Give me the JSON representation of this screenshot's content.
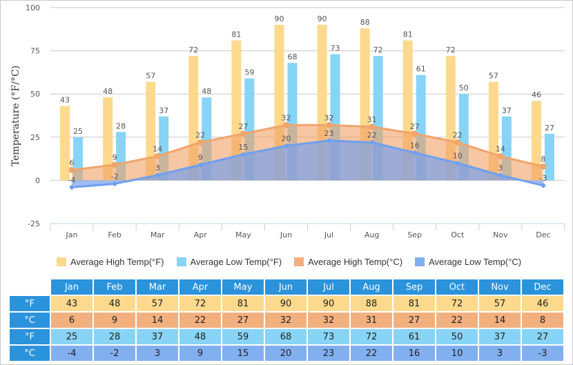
{
  "chart_data": {
    "type": "bar",
    "title": "",
    "xlabel": "",
    "ylabel": "Temperature (°F/°C)",
    "ylim": [
      -25,
      100
    ],
    "yticks": [
      -25,
      0,
      25,
      50,
      75,
      100
    ],
    "grid": true,
    "categories": [
      "Jan",
      "Feb",
      "Mar",
      "Apr",
      "May",
      "Jun",
      "Jul",
      "Aug",
      "Sep",
      "Oct",
      "Nov",
      "Dec"
    ],
    "series": [
      {
        "name": "Average High Temp(°F)",
        "type": "bar",
        "color": "#fcd98c",
        "values": [
          43,
          48,
          57,
          72,
          81,
          90,
          90,
          88,
          81,
          72,
          57,
          46
        ]
      },
      {
        "name": "Average Low Temp(°F)",
        "type": "bar",
        "color": "#88d4f6",
        "values": [
          25,
          28,
          37,
          48,
          59,
          68,
          73,
          72,
          61,
          50,
          37,
          27
        ]
      },
      {
        "name": "Average High Temp(°C)",
        "type": "area",
        "color": "#f2b07e",
        "values": [
          6,
          9,
          14,
          22,
          27,
          32,
          32,
          31,
          27,
          22,
          14,
          8
        ]
      },
      {
        "name": "Average Low Temp(°C)",
        "type": "area",
        "color": "#82aff0",
        "values": [
          -4,
          -2,
          3,
          9,
          15,
          20,
          23,
          22,
          16,
          10,
          3,
          -3
        ]
      }
    ],
    "legend_position": "bottom"
  },
  "table": {
    "months": [
      "Jan",
      "Feb",
      "Mar",
      "Apr",
      "May",
      "Jun",
      "Jul",
      "Aug",
      "Sep",
      "Oct",
      "Nov",
      "Dec"
    ],
    "rows": [
      {
        "unit": "°F",
        "cls": "hiF",
        "values": [
          "43",
          "48",
          "57",
          "72",
          "81",
          "90",
          "90",
          "88",
          "81",
          "72",
          "57",
          "46"
        ]
      },
      {
        "unit": "°C",
        "cls": "hiC",
        "values": [
          "6",
          "9",
          "14",
          "22",
          "27",
          "32",
          "32",
          "31",
          "27",
          "22",
          "14",
          "8"
        ]
      },
      {
        "unit": "°F",
        "cls": "loF",
        "values": [
          "25",
          "28",
          "37",
          "48",
          "59",
          "68",
          "73",
          "72",
          "61",
          "50",
          "37",
          "27"
        ]
      },
      {
        "unit": "°C",
        "cls": "loC",
        "values": [
          "-4",
          "-2",
          "3",
          "9",
          "15",
          "20",
          "23",
          "22",
          "16",
          "10",
          "3",
          "-3"
        ]
      }
    ]
  }
}
